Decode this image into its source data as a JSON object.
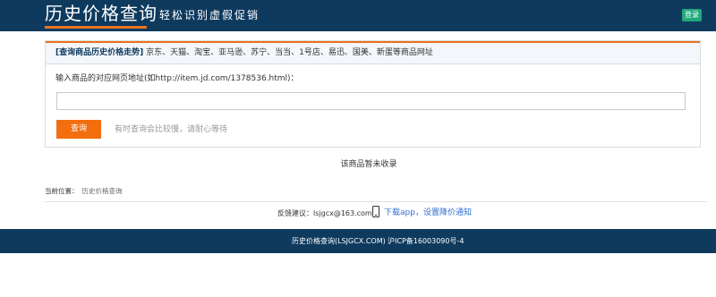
{
  "header": {
    "logo": "历史价格查询",
    "slogan": "轻松识别虚假促销",
    "login_label": "登录",
    "brand_color": "#0e3a5e",
    "accent_color": "#e8731f"
  },
  "search_panel": {
    "title_strong": "[查询商品历史价格走势]",
    "title_rest": "京东、天猫、淘宝、亚马逊、苏宁、当当、1号店、易迅、国美、新蛋等商品网址",
    "input_label": "输入商品的对应网页地址(如http://item.jd.com/1378536.html)：",
    "input_value": "",
    "input_placeholder": "",
    "query_button": "查询",
    "hint": "有时查询会比较慢，请耐心等待"
  },
  "result": {
    "message": "该商品暂未收录"
  },
  "breadcrumb": {
    "label": "当前位置：",
    "current": "历史价格查询"
  },
  "feedback": {
    "text": "反馈建议：lsjgcx@163.com",
    "app_icon": "phone-icon",
    "app_link": "下载app，设置降价通知"
  },
  "footer": {
    "site": "历史价格查询(LSJGCX.COM)",
    "icp": "沪ICP备16003090号-4"
  }
}
